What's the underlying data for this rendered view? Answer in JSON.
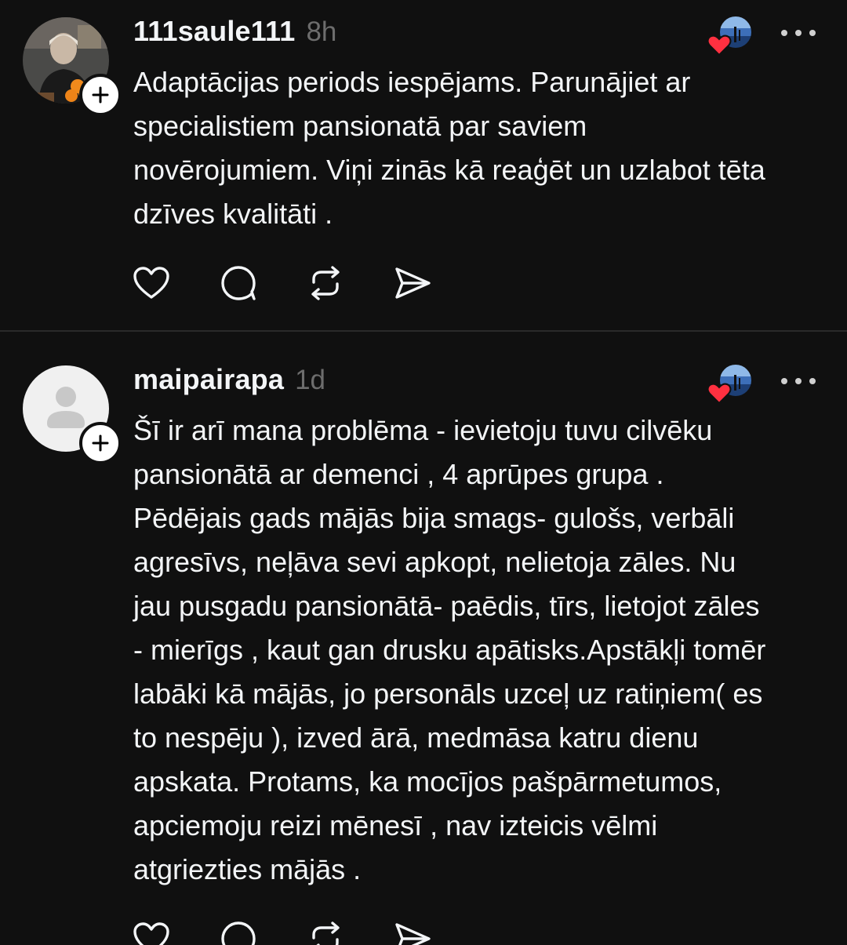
{
  "posts": [
    {
      "username": "111saule111",
      "time": "8h",
      "text": "Adaptācijas periods iespējams. Parunājiet ar\nspecialistiem pansionatā  par saviem\nnovērojumiem. Viņi zinās kā reaģēt un uzlabot tēta\ndzīves kvalitāti .",
      "avatar_icon": "profile-photo",
      "liked_by_icon": "heart-icon",
      "actions": [
        "heart-icon",
        "comment-icon",
        "repost-icon",
        "share-icon"
      ]
    },
    {
      "username": "maipairapa",
      "time": "1d",
      "text": "Šī ir arī mana problēma - ievietoju tuvu cilvēku\npansionātā ar demenci , 4 aprūpes grupa .\nPēdējais gads mājās bija smags- gulošs, verbāli\nagresīvs, neļāva sevi apkopt, nelietoja zāles. Nu\njau pusgadu pansionātā- paēdis, tīrs, lietojot zāles\n- mierīgs , kaut gan drusku apātisks.Apstākļi tomēr\nlabāki kā mājās, jo personāls uzceļ uz ratiņiem( es\nto nespēju ), izved ārā, medmāsa katru dienu\napskata. Protams, ka mocījos pašpārmetumos,\napciemoju reizi mēnesī , nav izteicis vēlmi\natgriezties mājās .",
      "avatar_icon": "default-user-icon",
      "liked_by_icon": "heart-icon",
      "actions": [
        "heart-icon",
        "comment-icon",
        "repost-icon",
        "share-icon"
      ]
    }
  ],
  "colors": {
    "background": "#101010",
    "text": "#f3f5f7",
    "muted": "#6d6d6d",
    "divider": "#2a2a2a",
    "heart": "#ff3040"
  }
}
